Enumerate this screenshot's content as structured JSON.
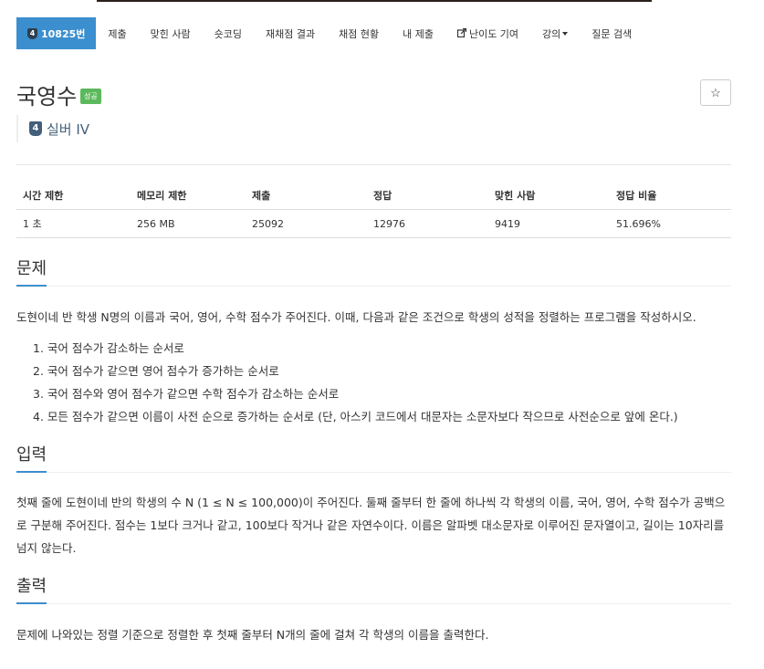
{
  "nav": {
    "problem_number": "10825번",
    "tier_badge": "4",
    "items": [
      "제출",
      "맞힌 사람",
      "숏코딩",
      "재채점 결과",
      "채점 현황",
      "내 제출",
      "난이도 기여",
      "강의",
      "질문 검색"
    ]
  },
  "problem": {
    "title": "국영수",
    "status_badge": "성공",
    "star": "☆",
    "tier_number": "4",
    "tier": "실버 IV"
  },
  "info_table": {
    "headers": [
      "시간 제한",
      "메모리 제한",
      "제출",
      "정답",
      "맞힌 사람",
      "정답 비율"
    ],
    "values": [
      "1 초",
      "256 MB",
      "25092",
      "12976",
      "9419",
      "51.696%"
    ]
  },
  "sections": {
    "description": {
      "heading": "문제",
      "text": "도현이네 반 학생 N명의 이름과 국어, 영어, 수학 점수가 주어진다. 이때, 다음과 같은 조건으로 학생의 성적을 정렬하는 프로그램을 작성하시오.",
      "conditions": [
        "1. 국어 점수가 감소하는 순서로",
        "2. 국어 점수가 같으면 영어 점수가 증가하는 순서로",
        "3. 국어 점수와 영어 점수가 같으면 수학 점수가 감소하는 순서로",
        "4. 모든 점수가 같으면 이름이 사전 순으로 증가하는 순서로 (단, 아스키 코드에서 대문자는 소문자보다 작으므로 사전순으로 앞에 온다.)"
      ]
    },
    "input": {
      "heading": "입력",
      "text": "첫째 줄에 도현이네 반의 학생의 수 N (1 ≤ N ≤ 100,000)이 주어진다. 둘째 줄부터 한 줄에 하나씩 각 학생의 이름, 국어, 영어, 수학 점수가 공백으로 구분해 주어진다. 점수는 1보다 크거나 같고, 100보다 작거나 같은 자연수이다. 이름은 알파벳 대소문자로 이루어진 문자열이고, 길이는 10자리를 넘지 않는다."
    },
    "output": {
      "heading": "출력",
      "text": "문제에 나와있는 정렬 기준으로 정렬한 후 첫째 줄부터 N개의 줄에 걸쳐 각 학생의 이름을 출력한다."
    }
  }
}
